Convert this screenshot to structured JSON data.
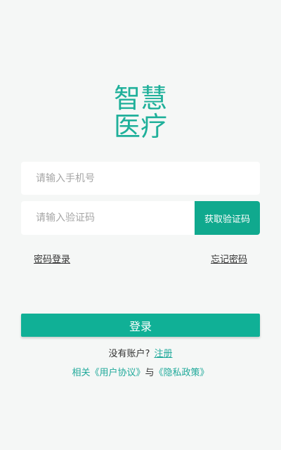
{
  "logo": {
    "line1": "智慧",
    "line2": "医疗"
  },
  "phone": {
    "placeholder": "请输入手机号",
    "value": ""
  },
  "code": {
    "placeholder": "请输入验证码",
    "value": "",
    "button_label": "获取验证码"
  },
  "links": {
    "password_login": "密码登录",
    "forgot_password": "忘记密码"
  },
  "login_button": "登录",
  "register": {
    "prompt": "没有账户?",
    "link": "注册"
  },
  "agreement": {
    "prefix": "相关",
    "user_agreement": "《用户协议》",
    "conjunction": "与",
    "privacy_policy": "《隐私政策》"
  },
  "colors": {
    "accent": "#10b096",
    "background": "#f5f7f6",
    "link": "#1fa99a"
  }
}
